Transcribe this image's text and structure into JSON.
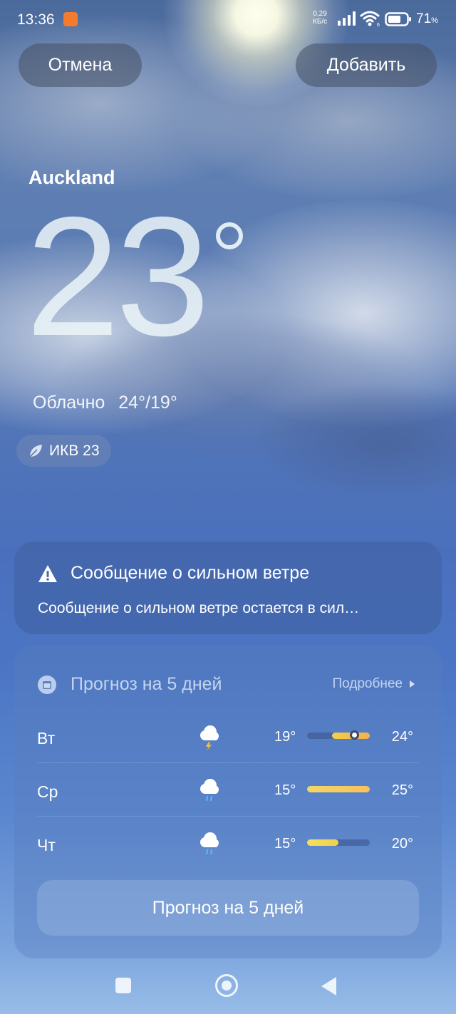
{
  "status_bar": {
    "time": "13:36",
    "net_speed_value": "0,29",
    "net_speed_unit": "КБ/с",
    "battery_percent": "71",
    "battery_symbol": "%",
    "battery_level": 0.71
  },
  "header": {
    "cancel_label": "Отмена",
    "add_label": "Добавить"
  },
  "weather": {
    "city": "Auckland",
    "temperature": "23",
    "condition": "Облачно",
    "range": "24°/19°",
    "aqi_label": "ИКВ 23"
  },
  "alert": {
    "title": "Сообщение о сильном ветре",
    "text": "Сообщение о сильном ветре остается в сил…"
  },
  "forecast": {
    "title": "Прогноз на 5 дней",
    "more_label": "Подробнее",
    "button_label": "Прогноз на 5 дней",
    "days": [
      {
        "day": "Вт",
        "icon": "thunderstorm-icon",
        "low": "19°",
        "high": "24°"
      },
      {
        "day": "Ср",
        "icon": "rain-icon",
        "low": "15°",
        "high": "25°"
      },
      {
        "day": "Чт",
        "icon": "rain-icon",
        "low": "15°",
        "high": "20°"
      }
    ]
  },
  "colors": {
    "accent_yellow": "#f2d04a",
    "accent_orange": "#f6b04a",
    "app_badge": "#f27b2d"
  }
}
